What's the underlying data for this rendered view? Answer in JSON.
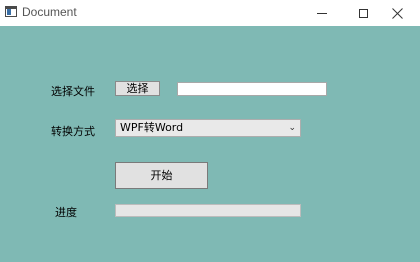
{
  "window": {
    "title": "Document",
    "app_icon": "document-window-icon",
    "controls": {
      "minimize": "─",
      "maximize": "☐",
      "close": "✕"
    }
  },
  "form": {
    "select_file_label": "选择文件",
    "select_button_label": "选择",
    "file_path_value": "",
    "conversion_mode_label": "转换方式",
    "conversion_mode_selected": "WPF转Word",
    "start_button_label": "开始",
    "progress_label": "进度",
    "progress_value": 0
  },
  "colors": {
    "client_background": "#7fb9b4",
    "titlebar_background": "#ffffff"
  }
}
